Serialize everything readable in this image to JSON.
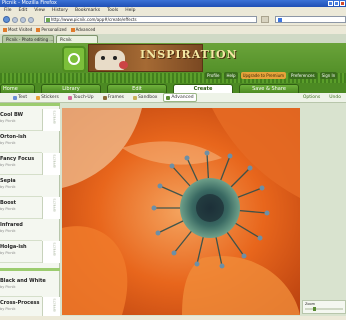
{
  "browser": {
    "title": "Picnik - Mozilla Firefox",
    "menu": [
      "File",
      "Edit",
      "View",
      "History",
      "Bookmarks",
      "Tools",
      "Help"
    ],
    "url": "http://www.picnik.com/app#/create/effects",
    "bookmarks": [
      "Most Visited",
      "Personalized",
      "Advanced"
    ],
    "tabs": [
      "Picnik - Photo editing ...",
      "Picnik"
    ]
  },
  "site": {
    "banner_title": "INSPIRATION",
    "profile_items": [
      "Profile",
      "Help",
      "Upgrade to Premium",
      "Preferences",
      "Sign In"
    ],
    "nav": [
      "Home",
      "Library",
      "Edit",
      "Create",
      "Save & Share"
    ],
    "active_nav": "Create"
  },
  "toolbar": {
    "tools": [
      "Text",
      "Stickers",
      "Touch-Up",
      "Frames",
      "Sandbox",
      "Advanced"
    ],
    "options": "Options",
    "undo": "Undo"
  },
  "effects": [
    {
      "name": "Cool BW",
      "by": "by Picnik"
    },
    {
      "name": "Orton-ish",
      "by": "by Picnik"
    },
    {
      "name": "Fancy Focus",
      "by": "by Picnik"
    },
    {
      "name": "Sepia",
      "by": "by Picnik"
    },
    {
      "name": "Boost",
      "by": "by Picnik"
    },
    {
      "name": "Infrared",
      "by": "by Picnik"
    },
    {
      "name": "Holga-ish",
      "by": "by Picnik"
    },
    {
      "name": "Black and White",
      "by": "by Picnik"
    },
    {
      "name": "Cross-Process",
      "by": "by Picnik"
    }
  ],
  "effect_tab_label": "EFFECTS",
  "zoom": {
    "label": "Zoom"
  },
  "colors": {
    "green": "#4c8a23",
    "accent": "#e7a33a",
    "petal": "#e0641d"
  }
}
